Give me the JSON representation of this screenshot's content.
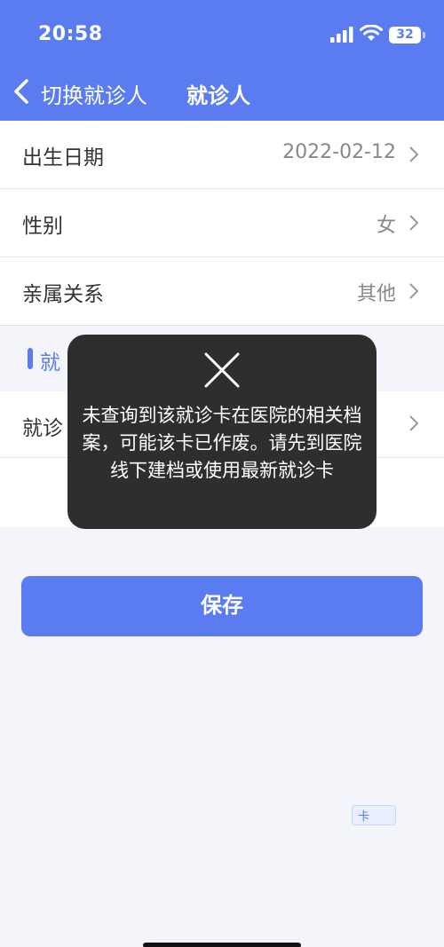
{
  "status_bar": {
    "time": "20:58",
    "battery": "32"
  },
  "nav": {
    "back_label": "切换就诊人",
    "title": "就诊人"
  },
  "rows": [
    {
      "label": "出生日期",
      "value": "2022-02-12"
    },
    {
      "label": "性别",
      "value": "女"
    },
    {
      "label": "亲属关系",
      "value": "其他"
    }
  ],
  "card_section": {
    "title": "就",
    "row_label": "就诊",
    "tag": "卡"
  },
  "save_button": {
    "label": "保存"
  },
  "toast": {
    "message": "未查询到该就诊卡在医院的相关档案，可能该卡已作废。请先到医院线下建档或使用最新就诊卡"
  },
  "colors": {
    "accent": "#5b7cf0",
    "toast_bg": "#1e1e1e",
    "page_bg": "#f4f5fa"
  }
}
